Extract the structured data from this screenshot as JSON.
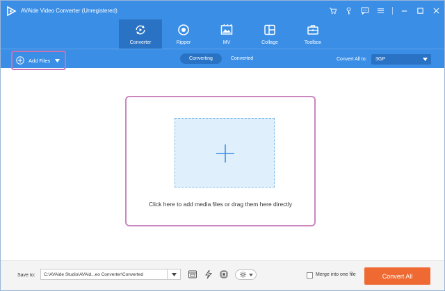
{
  "window": {
    "title": "AVAide Video Converter (Unregistered)"
  },
  "nav": {
    "tabs": [
      {
        "label": "Converter",
        "icon": "converter-icon",
        "active": true
      },
      {
        "label": "Ripper",
        "icon": "ripper-icon",
        "active": false
      },
      {
        "label": "MV",
        "icon": "mv-icon",
        "active": false
      },
      {
        "label": "Collage",
        "icon": "collage-icon",
        "active": false
      },
      {
        "label": "Toolbox",
        "icon": "toolbox-icon",
        "active": false
      }
    ]
  },
  "toolbar": {
    "add_files_label": "Add Files",
    "segments": [
      {
        "label": "Converting",
        "active": true
      },
      {
        "label": "Converted",
        "active": false
      }
    ],
    "convert_all_label": "Convert All to:",
    "format_value": "3GP"
  },
  "drop": {
    "hint": "Click here to add media files or drag them here directly"
  },
  "footer": {
    "save_label": "Save to:",
    "save_path": "C:\\AVAide Studio\\AVAid...eo Converter\\Converted",
    "merge_label": "Merge into one file",
    "convert_button": "Convert All"
  },
  "colors": {
    "header": "#3a8ee6",
    "active_tab": "#2a73c4",
    "highlight": "#c873b5",
    "drop_fill": "#dff0fc",
    "convert": "#ef6a33"
  }
}
